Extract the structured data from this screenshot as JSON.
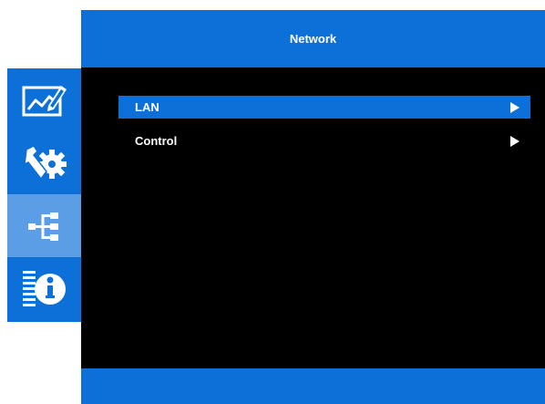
{
  "header": {
    "title": "Network"
  },
  "sidebar": {
    "items": [
      {
        "icon": "image-adjust-icon",
        "active": false
      },
      {
        "icon": "setup-tools-icon",
        "active": false
      },
      {
        "icon": "network-icon",
        "active": true
      },
      {
        "icon": "info-icon",
        "active": false
      }
    ]
  },
  "menu": {
    "items": [
      {
        "label": "LAN",
        "selected": true,
        "icon": "submenu-arrow-icon"
      },
      {
        "label": "Control",
        "selected": false,
        "icon": "submenu-arrow-icon"
      }
    ]
  },
  "colors": {
    "accent": "#0d6fd8",
    "active_tab": "#5c9ee6",
    "panel": "#000000",
    "text": "#ffffff"
  }
}
